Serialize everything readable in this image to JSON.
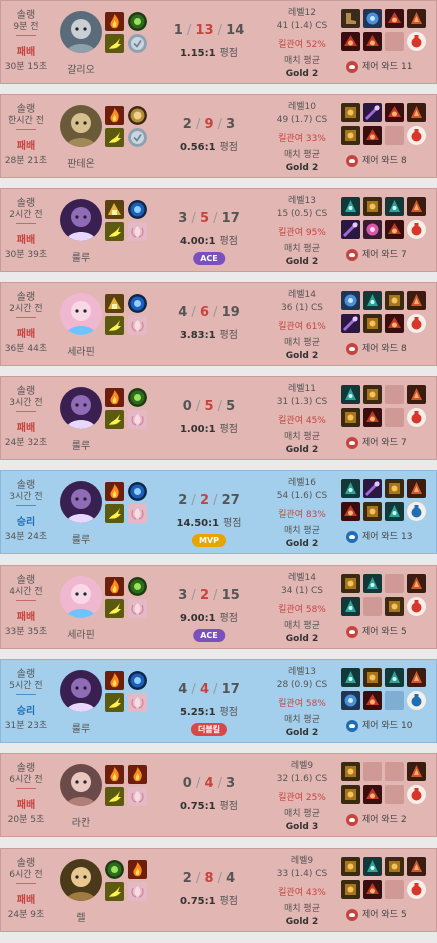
{
  "labels": {
    "average_label": "평점",
    "match_average": "매치 평균",
    "ward_label": "제어 와드",
    "kp_prefix": "킬관여"
  },
  "colors": {
    "lose_bg": "#e2b6b3",
    "win_bg": "#a3cfec",
    "death_red": "#c6443e",
    "ace_badge": "#7a4fc0",
    "mvp_badge": "#e8a400",
    "double_kill_badge": "#d94848"
  },
  "matches": [
    {
      "mode": "솔랭",
      "ago": "9분 전",
      "result": "패배",
      "outcome": "lose",
      "duration": "30분 15초",
      "champion": "갈리오",
      "portrait_theme": "galio",
      "kills": "1",
      "deaths": "13",
      "assists": "14",
      "ratio": "1.15:1",
      "badge": "",
      "badge_type": "",
      "level": "레벨12",
      "cs": "41 (1.4) CS",
      "kp": "킬관여 52%",
      "tier": "Gold 2",
      "wards": "11",
      "spells": [
        "ignite",
        "ghost",
        "flash",
        "cleanse"
      ],
      "items": [
        "item-boots",
        "item-blue",
        "item-red",
        "item-trinket",
        "item-red",
        "item-red",
        "item-empty",
        "item-potion"
      ]
    },
    {
      "mode": "솔랭",
      "ago": "한시간 전",
      "result": "패배",
      "outcome": "lose",
      "duration": "28분 21초",
      "champion": "판테온",
      "portrait_theme": "pantheon",
      "kills": "2",
      "deaths": "9",
      "assists": "3",
      "ratio": "0.56:1",
      "badge": "",
      "badge_type": "",
      "level": "레벨10",
      "cs": "49 (1.7) CS",
      "kp": "킬관여 33%",
      "tier": "Gold 2",
      "wards": "8",
      "spells": [
        "ignite",
        "lion",
        "flash",
        "cleanse"
      ],
      "items": [
        "item-gold",
        "item-purple",
        "item-red",
        "item-trinket",
        "item-gold",
        "item-red",
        "item-empty",
        "item-potion"
      ]
    },
    {
      "mode": "솔랭",
      "ago": "2시간 전",
      "result": "패배",
      "outcome": "lose",
      "duration": "30분 39초",
      "champion": "룰루",
      "portrait_theme": "lulu",
      "kills": "3",
      "deaths": "5",
      "assists": "17",
      "ratio": "4.00:1",
      "badge": "ACE",
      "badge_type": "ace",
      "level": "레벨13",
      "cs": "15 (0.5) CS",
      "kp": "킬관여 95%",
      "tier": "Gold 2",
      "wards": "7",
      "spells": [
        "gold",
        "blue",
        "flash",
        "pink"
      ],
      "items": [
        "item-teal",
        "item-gold",
        "item-teal",
        "item-trinket",
        "item-purple",
        "item-pink",
        "item-red",
        "item-potion"
      ]
    },
    {
      "mode": "솔랭",
      "ago": "2시간 전",
      "result": "패배",
      "outcome": "lose",
      "duration": "36분 44초",
      "champion": "세라핀",
      "portrait_theme": "seraphine",
      "kills": "4",
      "deaths": "6",
      "assists": "19",
      "ratio": "3.83:1",
      "badge": "",
      "badge_type": "",
      "level": "레벨14",
      "cs": "36 (1) CS",
      "kp": "킬관여 61%",
      "tier": "Gold 2",
      "wards": "8",
      "spells": [
        "gold",
        "blue",
        "flash",
        "pink"
      ],
      "items": [
        "item-blue",
        "item-teal",
        "item-gold",
        "item-trinket",
        "item-purple",
        "item-gold",
        "item-red",
        "item-potion"
      ]
    },
    {
      "mode": "솔랭",
      "ago": "3시간 전",
      "result": "패배",
      "outcome": "lose",
      "duration": "24분 32초",
      "champion": "룰루",
      "portrait_theme": "lulu",
      "kills": "0",
      "deaths": "5",
      "assists": "5",
      "ratio": "1.00:1",
      "badge": "",
      "badge_type": "",
      "level": "레벨11",
      "cs": "31 (1.3) CS",
      "kp": "킬관여 45%",
      "tier": "Gold 2",
      "wards": "7",
      "spells": [
        "ignite",
        "green",
        "flash",
        "pink"
      ],
      "items": [
        "item-teal",
        "item-gold",
        "item-empty",
        "item-trinket",
        "item-gold",
        "item-red",
        "item-empty",
        "item-potion"
      ]
    },
    {
      "mode": "솔랭",
      "ago": "3시간 전",
      "result": "승리",
      "outcome": "win",
      "duration": "34분 24초",
      "champion": "룰루",
      "portrait_theme": "lulu",
      "kills": "2",
      "deaths": "2",
      "assists": "27",
      "ratio": "14.50:1",
      "badge": "MVP",
      "badge_type": "mvp",
      "level": "레벨16",
      "cs": "54 (1.6) CS",
      "kp": "킬관여 83%",
      "tier": "Gold 2",
      "wards": "13",
      "spells": [
        "ignite",
        "blue",
        "flash",
        "pink"
      ],
      "items": [
        "item-teal",
        "item-purple",
        "item-gold",
        "item-trinket",
        "item-red",
        "item-gold",
        "item-teal",
        "item-potion-blue"
      ]
    },
    {
      "mode": "솔랭",
      "ago": "4시간 전",
      "result": "패배",
      "outcome": "lose",
      "duration": "33분 35초",
      "champion": "세라핀",
      "portrait_theme": "seraphine",
      "kills": "3",
      "deaths": "2",
      "assists": "15",
      "ratio": "9.00:1",
      "badge": "ACE",
      "badge_type": "ace",
      "level": "레벨14",
      "cs": "34 (1) CS",
      "kp": "킬관여 58%",
      "tier": "Gold 2",
      "wards": "5",
      "spells": [
        "ignite",
        "green",
        "flash",
        "pink"
      ],
      "items": [
        "item-gold",
        "item-teal",
        "item-empty",
        "item-trinket",
        "item-teal",
        "item-empty",
        "item-gold",
        "item-potion"
      ]
    },
    {
      "mode": "솔랭",
      "ago": "5시간 전",
      "result": "승리",
      "outcome": "win",
      "duration": "31분 23초",
      "champion": "룰루",
      "portrait_theme": "lulu",
      "kills": "4",
      "deaths": "4",
      "assists": "17",
      "ratio": "5.25:1",
      "badge": "더블킬",
      "badge_type": "double",
      "level": "레벨13",
      "cs": "28 (0.9) CS",
      "kp": "킬관여 58%",
      "tier": "Gold 2",
      "wards": "10",
      "spells": [
        "ignite",
        "blue",
        "flash",
        "pink"
      ],
      "items": [
        "item-teal",
        "item-gold",
        "item-teal",
        "item-trinket",
        "item-blue",
        "item-red",
        "item-empty",
        "item-potion-blue"
      ]
    },
    {
      "mode": "솔랭",
      "ago": "6시간 전",
      "result": "패배",
      "outcome": "lose",
      "duration": "20분 5초",
      "champion": "라칸",
      "portrait_theme": "rakan",
      "kills": "0",
      "deaths": "4",
      "assists": "3",
      "ratio": "0.75:1",
      "badge": "",
      "badge_type": "",
      "level": "레벨9",
      "cs": "32 (1.6) CS",
      "kp": "킬관여 25%",
      "tier": "Gold 3",
      "wards": "2",
      "spells": [
        "ignite",
        "ignite",
        "flash",
        "pink"
      ],
      "items": [
        "item-gold",
        "item-empty",
        "item-empty",
        "item-trinket",
        "item-gold",
        "item-red",
        "item-empty",
        "item-potion"
      ]
    },
    {
      "mode": "솔랭",
      "ago": "6시간 전",
      "result": "패배",
      "outcome": "lose",
      "duration": "24분 9초",
      "champion": "렐",
      "portrait_theme": "rell",
      "kills": "2",
      "deaths": "8",
      "assists": "4",
      "ratio": "0.75:1",
      "badge": "",
      "badge_type": "",
      "level": "레벨9",
      "cs": "33 (1.4) CS",
      "kp": "킬관여 43%",
      "tier": "Gold 2",
      "wards": "5",
      "spells": [
        "green",
        "ignite",
        "flash",
        "pink"
      ],
      "items": [
        "item-gold",
        "item-teal",
        "item-gold",
        "item-trinket",
        "item-gold",
        "item-red",
        "item-empty",
        "item-potion"
      ]
    }
  ]
}
